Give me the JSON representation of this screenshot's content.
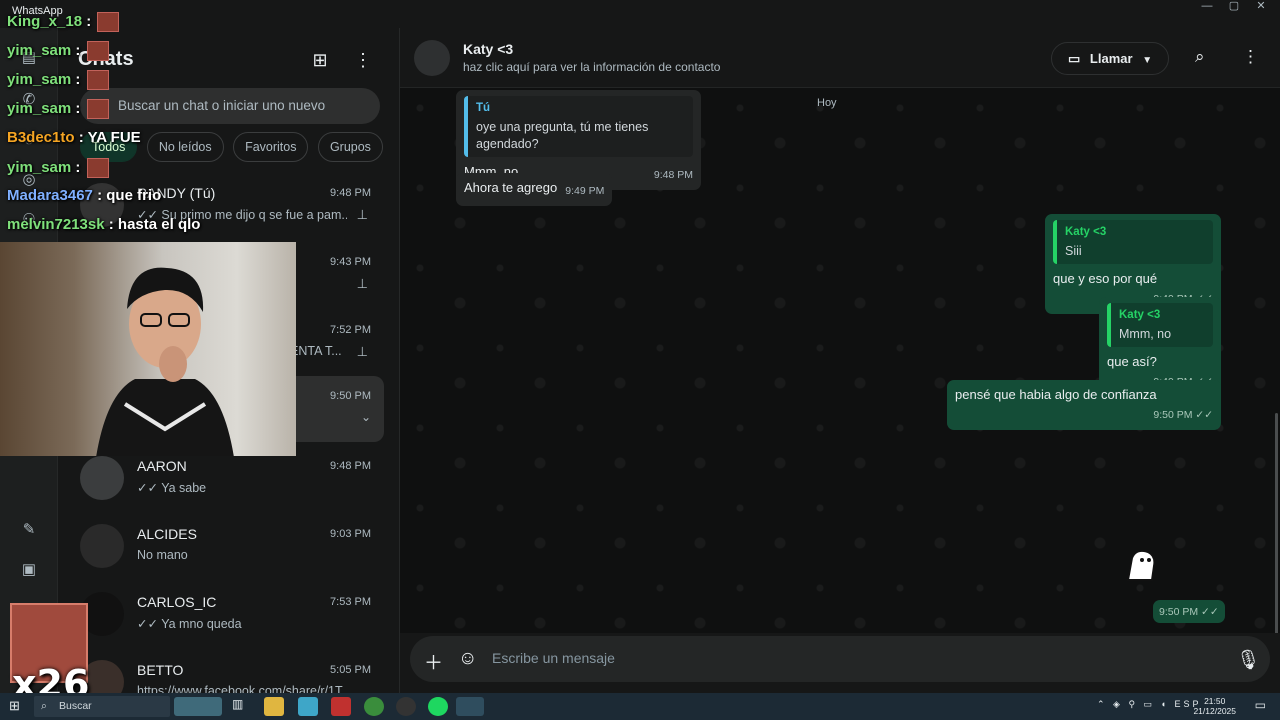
{
  "titlebar": {
    "app_name": "WhatsApp"
  },
  "sidebar": {
    "title": "Chats",
    "search_placeholder": "Buscar un chat o iniciar uno nuevo",
    "filters": [
      "Todos",
      "No leídos",
      "Favoritos",
      "Grupos"
    ],
    "chats": [
      {
        "name": "RANDY (Tú)",
        "time": "9:48 PM",
        "preview": "✓✓ Su primo me dijo q se fue a pam...",
        "pinned": true
      },
      {
        "name": "",
        "time": "9:43 PM",
        "preview": "",
        "pinned": true
      },
      {
        "name": "",
        "time": "7:52 PM",
        "preview": "ENTA T...",
        "pinned": true
      },
      {
        "name": "",
        "time": "9:50 PM",
        "preview": "",
        "pinned": false,
        "selected": true
      },
      {
        "name": "AARON",
        "time": "9:48 PM",
        "preview": "✓✓ Ya sabe",
        "pinned": false
      },
      {
        "name": "ALCIDES",
        "time": "9:03 PM",
        "preview": "No mano",
        "pinned": false
      },
      {
        "name": "CARLOS_IC",
        "time": "7:53 PM",
        "preview": "✓✓ Ya mno queda",
        "pinned": false
      },
      {
        "name": "BETTO",
        "time": "5:05 PM",
        "preview": "https://www.facebook.com/share/r/1T...",
        "pinned": false
      }
    ]
  },
  "conversation": {
    "contact_name": "Katy <3",
    "contact_subtitle": "haz clic aquí para ver la información de contacto",
    "call_label": "Llamar",
    "day_label": "Hoy",
    "messages": [
      {
        "dir": "in",
        "quote_name": "Tú",
        "quote_text": "oye una pregunta, tú me tienes agendado?",
        "text": "Mmm, no",
        "time": "9:48 PM"
      },
      {
        "dir": "in",
        "text": "Ahora te agrego",
        "time": "9:49 PM"
      },
      {
        "dir": "out",
        "quote_name": "Katy <3",
        "quote_text": "Siii",
        "text": "que y eso por qué",
        "time": "9:49 PM"
      },
      {
        "dir": "out",
        "quote_name": "Katy <3",
        "quote_text": "Mmm, no",
        "text": "que así?",
        "time": "9:49 PM"
      },
      {
        "dir": "out",
        "text": "pensé que habia algo de confianza",
        "time": "9:50 PM"
      },
      {
        "dir": "out",
        "text": "",
        "time": "9:50 PM",
        "sticker": true
      }
    ],
    "composer_placeholder": "Escribe un mensaje"
  },
  "stream_chat": [
    {
      "user": "King_x_18",
      "text": "",
      "color": "green"
    },
    {
      "user": "yim_sam",
      "text": "",
      "color": "green"
    },
    {
      "user": "yim_sam",
      "text": "",
      "color": "green"
    },
    {
      "user": "yim_sam",
      "text": "",
      "color": "green"
    },
    {
      "user": "B3dec1to",
      "text": "YA FUE",
      "color": "orange"
    },
    {
      "user": "yim_sam",
      "text": "",
      "color": "green"
    },
    {
      "user": "Madara3467",
      "text": "que frio",
      "color": "blue"
    },
    {
      "user": "melvin7213sk",
      "text": "hasta el qlo",
      "color": "green"
    }
  ],
  "overlay": {
    "combo": "x26"
  },
  "taskbar": {
    "search_label": "Buscar",
    "lang": "ESP",
    "time": "21:50",
    "date": "21/12/2025"
  },
  "colors": {
    "accent": "#25d366",
    "outgoing_bubble": "#144d37",
    "incoming_bubble": "#242626",
    "background": "#161717"
  }
}
